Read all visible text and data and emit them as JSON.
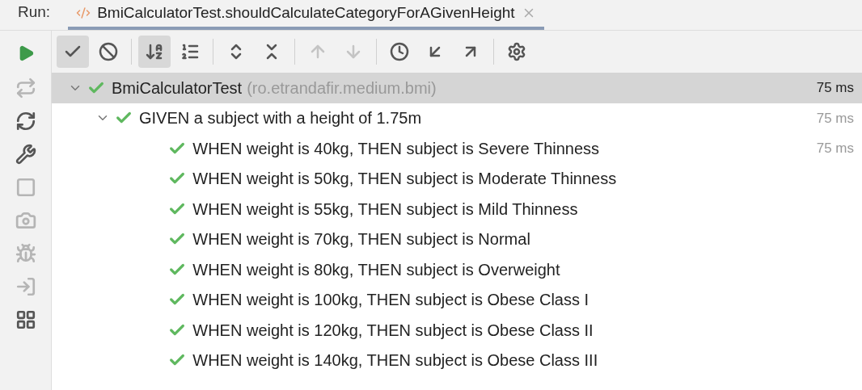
{
  "run_bar": {
    "label": "Run:",
    "tab": {
      "title": "BmiCalculatorTest.shouldCalculateCategoryForAGivenHeight",
      "selected": true
    }
  },
  "toolbar": [
    {
      "selected": true,
      "disabled": false
    },
    {
      "selected": false,
      "disabled": false
    },
    {
      "selected": true,
      "disabled": false
    },
    {
      "selected": false,
      "disabled": false
    },
    {
      "selected": false,
      "disabled": false
    },
    {
      "selected": false,
      "disabled": false
    },
    {
      "selected": false,
      "disabled": true
    },
    {
      "selected": false,
      "disabled": true
    },
    {
      "selected": false,
      "disabled": false
    },
    {
      "selected": false,
      "disabled": false
    },
    {
      "selected": false,
      "disabled": false
    },
    {
      "selected": false,
      "disabled": false
    }
  ],
  "tree": [
    {
      "name": "BmiCalculatorTest",
      "package": "(ro.etrandafir.medium.bmi)",
      "time": "75 ms",
      "passed": true,
      "selected": true,
      "expanded": true,
      "children": [
        {
          "name": "GIVEN a subject with a height of 1.75m",
          "time": "75 ms",
          "passed": true,
          "selected": false,
          "expanded": true,
          "children": [
            {
              "name": "WHEN weight is 40kg, THEN subject is Severe Thinness",
              "time": "75 ms",
              "passed": true,
              "selected": false
            },
            {
              "name": "WHEN weight is 50kg, THEN subject is Moderate Thinness",
              "passed": true,
              "selected": false
            },
            {
              "name": "WHEN weight is 55kg, THEN subject is Mild Thinness",
              "passed": true,
              "selected": false
            },
            {
              "name": "WHEN weight is 70kg, THEN subject is Normal",
              "passed": true,
              "selected": false
            },
            {
              "name": "WHEN weight is 80kg, THEN subject is Overweight",
              "passed": true,
              "selected": false
            },
            {
              "name": "WHEN weight is 100kg, THEN subject is Obese Class I",
              "passed": true,
              "selected": false
            },
            {
              "name": "WHEN weight is 120kg, THEN subject is Obese Class II",
              "passed": true,
              "selected": false
            },
            {
              "name": "WHEN weight is 140kg, THEN subject is Obese Class III",
              "passed": true,
              "selected": false
            }
          ]
        }
      ]
    }
  ]
}
